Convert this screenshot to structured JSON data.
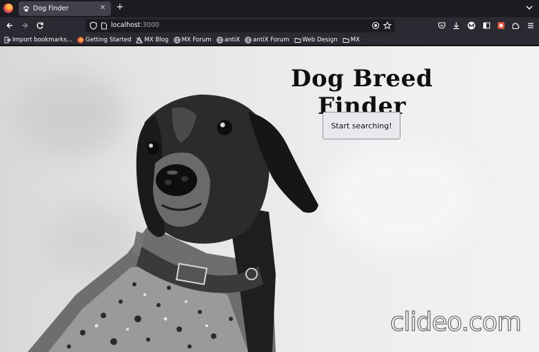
{
  "browser": {
    "tab": {
      "title": "Dog Finder",
      "close": "✕"
    },
    "new_tab": "+",
    "address": {
      "host": "localhost",
      "port": ":3000"
    }
  },
  "bookmarks": [
    {
      "label": "Import bookmarks...",
      "icon": "import-icon"
    },
    {
      "label": "Getting Started",
      "icon": "firefox-icon"
    },
    {
      "label": "MX Blog",
      "icon": "mx-logo-icon"
    },
    {
      "label": "MX Forum",
      "icon": "globe-icon"
    },
    {
      "label": "antiX",
      "icon": "globe-icon"
    },
    {
      "label": "antiX Forum",
      "icon": "globe-icon"
    },
    {
      "label": "Web Design",
      "icon": "folder-icon"
    },
    {
      "label": "MX",
      "icon": "folder-icon"
    }
  ],
  "page": {
    "title": "Dog Breed Finder",
    "button_label": "Start searching!",
    "watermark": "clideo.com"
  },
  "colors": {
    "tab_active": "#42414d",
    "toolbar": "#2b2a33",
    "tabstrip": "#1c1b22"
  }
}
